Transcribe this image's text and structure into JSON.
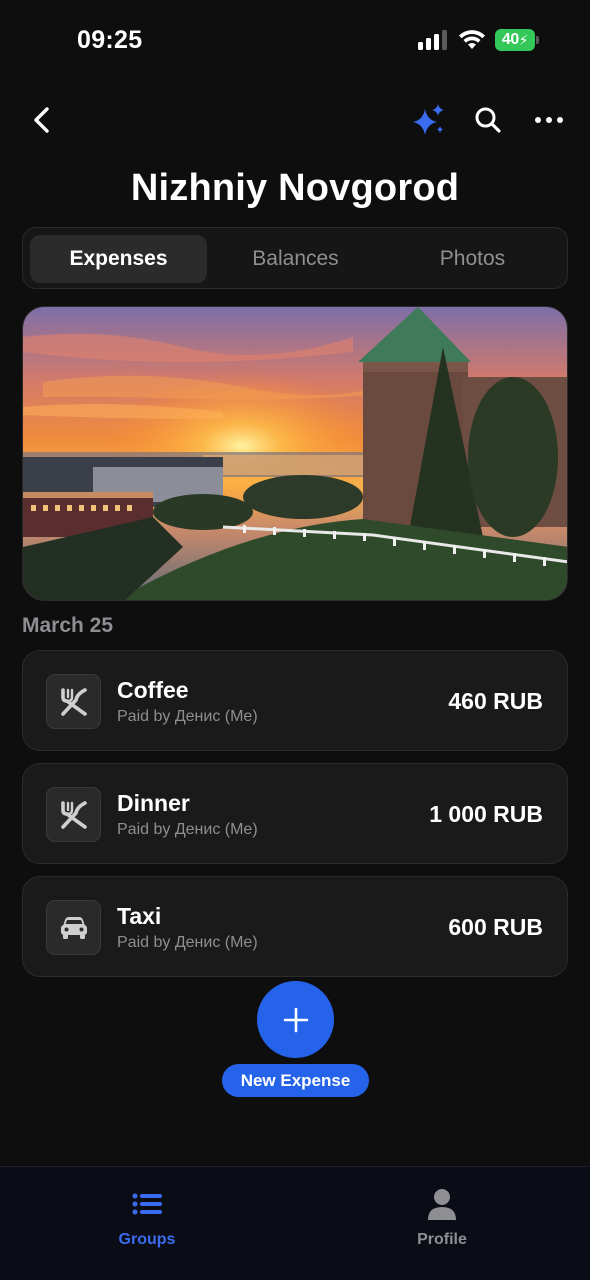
{
  "status_bar": {
    "time": "09:25",
    "battery": "40"
  },
  "header": {
    "title": "Nizhniy Novgorod",
    "icons": [
      "back-icon",
      "sparkle-icon",
      "search-icon",
      "more-icon"
    ]
  },
  "tabs": [
    {
      "label": "Expenses",
      "active": true
    },
    {
      "label": "Balances",
      "active": false
    },
    {
      "label": "Photos",
      "active": false
    }
  ],
  "section": {
    "date": "March 25"
  },
  "expenses": [
    {
      "title": "Coffee",
      "paid_by": "Paid by Денис (Me)",
      "amount": "460 RUB",
      "icon": "fork-knife-icon"
    },
    {
      "title": "Dinner",
      "paid_by": "Paid by Денис (Me)",
      "amount": "1 000 RUB",
      "icon": "fork-knife-icon"
    },
    {
      "title": "Taxi",
      "paid_by": "Paid by Денис (Me)",
      "amount": "600 RUB",
      "icon": "car-icon"
    }
  ],
  "fab": {
    "label": "New Expense"
  },
  "bottom_nav": [
    {
      "label": "Groups",
      "icon": "list-icon",
      "active": true
    },
    {
      "label": "Profile",
      "icon": "person-icon",
      "active": false
    }
  ],
  "colors": {
    "accent": "#2563eb",
    "background": "#0e0e0e",
    "card": "#1a1a1a",
    "battery": "#34c759"
  }
}
